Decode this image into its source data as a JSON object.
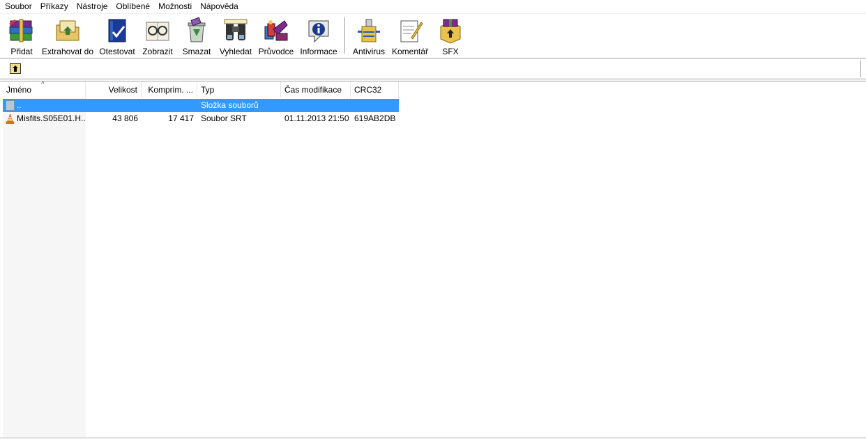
{
  "menu": [
    "Soubor",
    "Příkazy",
    "Nástroje",
    "Oblíbené",
    "Možnosti",
    "Nápověda"
  ],
  "toolbar": {
    "buttons": [
      {
        "label": "Přidat",
        "icon": "add-books-icon"
      },
      {
        "label": "Extrahovat do",
        "icon": "extract-folder-icon"
      },
      {
        "label": "Otestovat",
        "icon": "test-book-icon"
      },
      {
        "label": "Zobrazit",
        "icon": "view-glasses-icon"
      },
      {
        "label": "Smazat",
        "icon": "delete-recycle-icon"
      },
      {
        "label": "Vyhledat",
        "icon": "find-binoculars-icon"
      },
      {
        "label": "Průvodce",
        "icon": "wizard-icon"
      },
      {
        "label": "Informace",
        "icon": "info-icon"
      }
    ],
    "buttons2": [
      {
        "label": "Antivirus",
        "icon": "antivirus-icon"
      },
      {
        "label": "Komentář",
        "icon": "comment-icon"
      },
      {
        "label": "SFX",
        "icon": "sfx-box-icon"
      }
    ]
  },
  "columns": {
    "name": "Jméno",
    "size": "Velikost",
    "packed": "Komprim. ...",
    "type": "Typ",
    "mtime": "Čas modifikace",
    "crc": "CRC32"
  },
  "rows": [
    {
      "name": "..",
      "size": "",
      "packed": "",
      "type": "Složka souborů",
      "mtime": "",
      "crc": "",
      "icon": "folder-up-icon",
      "selected": true
    },
    {
      "name": "Misfits.S05E01.H...",
      "size": "43 806",
      "packed": "17 417",
      "type": "Soubor SRT",
      "mtime": "01.11.2013 21:50",
      "crc": "619AB2DB",
      "icon": "vlc-cone-icon",
      "selected": false
    }
  ],
  "colors": {
    "selection": "#3399ff"
  }
}
